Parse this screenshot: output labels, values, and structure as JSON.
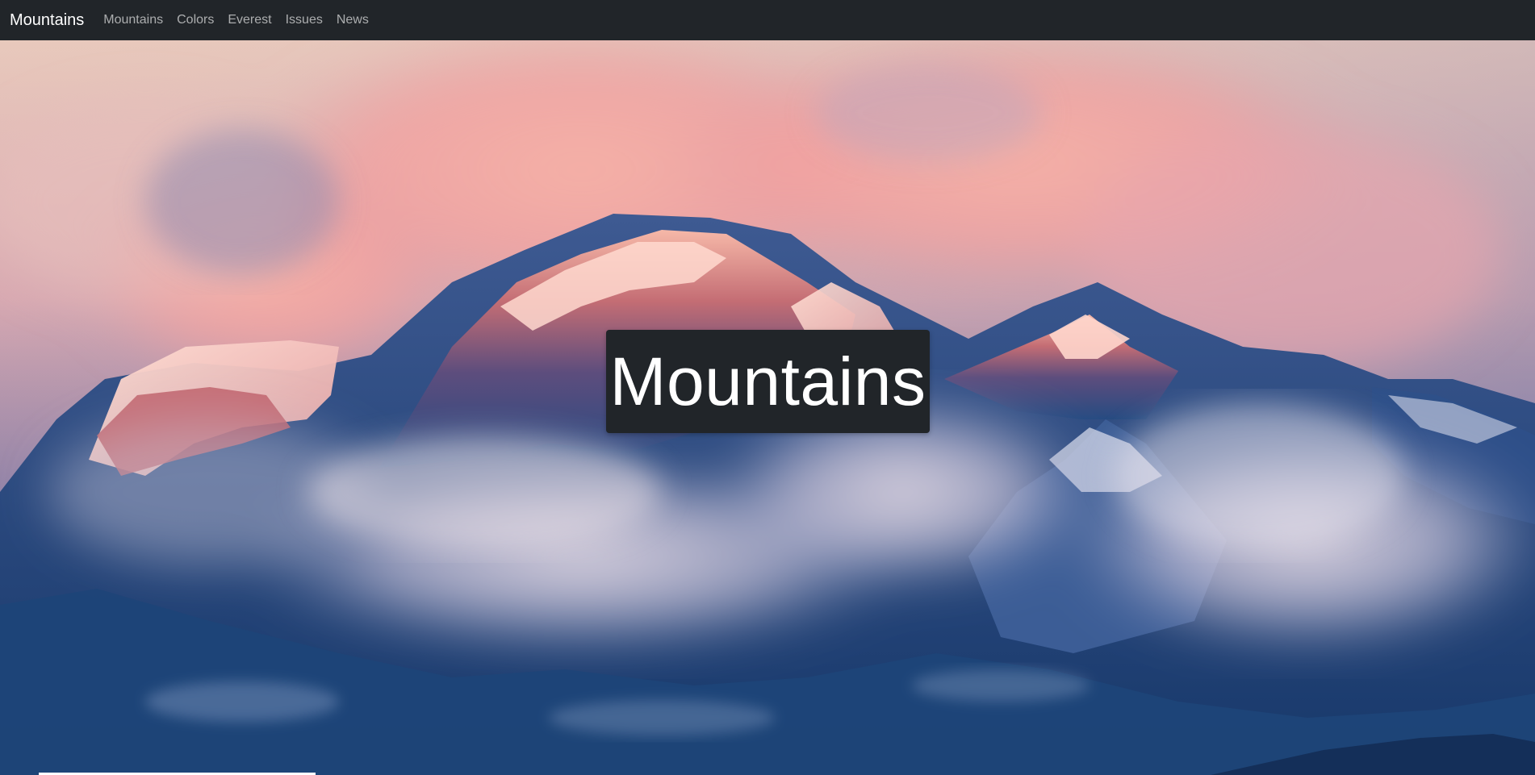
{
  "navbar": {
    "brand": "Mountains",
    "links": [
      "Mountains",
      "Colors",
      "Everest",
      "Issues",
      "News"
    ]
  },
  "hero": {
    "title": "Mountains",
    "background_description_colors": {
      "sky_top": "#e9c7bd",
      "cloud_pink": "#f4a7a2",
      "mountain_shadow": "#203f78",
      "title_box": "#212529"
    }
  }
}
